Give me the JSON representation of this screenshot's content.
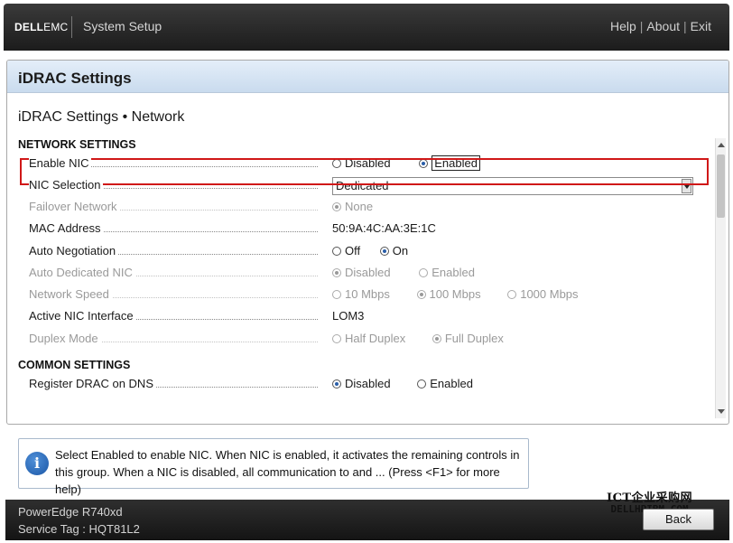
{
  "header": {
    "brand_bold": "DELL",
    "brand_light": "EMC",
    "title": "System Setup",
    "links": [
      "Help",
      "About",
      "Exit"
    ]
  },
  "panel": {
    "title": "iDRAC Settings",
    "subtitle": "iDRAC Settings • Network"
  },
  "network_settings": {
    "heading": "NETWORK SETTINGS",
    "enable_nic": {
      "label": "Enable NIC",
      "options": [
        "Disabled",
        "Enabled"
      ],
      "selected": "Enabled"
    },
    "nic_selection": {
      "label": "NIC Selection",
      "value": "Dedicated"
    },
    "failover_network": {
      "label": "Failover Network",
      "options": [
        "None"
      ],
      "selected": "None"
    },
    "mac_address": {
      "label": "MAC Address",
      "value": "50:9A:4C:AA:3E:1C"
    },
    "auto_negotiation": {
      "label": "Auto Negotiation",
      "options": [
        "Off",
        "On"
      ],
      "selected": "On"
    },
    "auto_dedicated_nic": {
      "label": "Auto Dedicated NIC",
      "options": [
        "Disabled",
        "Enabled"
      ],
      "selected": "Disabled"
    },
    "network_speed": {
      "label": "Network Speed",
      "options": [
        "10 Mbps",
        "100 Mbps",
        "1000 Mbps"
      ],
      "selected": "100 Mbps"
    },
    "active_nic_interface": {
      "label": "Active NIC Interface",
      "value": "LOM3"
    },
    "duplex_mode": {
      "label": "Duplex Mode",
      "options": [
        "Half Duplex",
        "Full Duplex"
      ],
      "selected": "Full Duplex"
    }
  },
  "common_settings": {
    "heading": "COMMON SETTINGS",
    "register_drac_on_dns": {
      "label": "Register DRAC on DNS",
      "options": [
        "Disabled",
        "Enabled"
      ],
      "selected": "Disabled"
    }
  },
  "help": {
    "icon": "info-icon",
    "text": "Select Enabled to enable NIC. When NIC is enabled, it activates the remaining controls in this group. When a NIC is disabled, all communication to and ... (Press <F1> for more help)"
  },
  "footer": {
    "model": "PowerEdge R740xd",
    "service_tag": "Service Tag : HQT81L2",
    "back_label": "Back"
  },
  "watermark": {
    "line1": "ICT企业采购网",
    "line2": "DELLHPIBM.COM"
  },
  "colors": {
    "highlight_border": "#d01818",
    "header_bg": "#1c1c1c",
    "panel_header": "#c9dbee"
  }
}
